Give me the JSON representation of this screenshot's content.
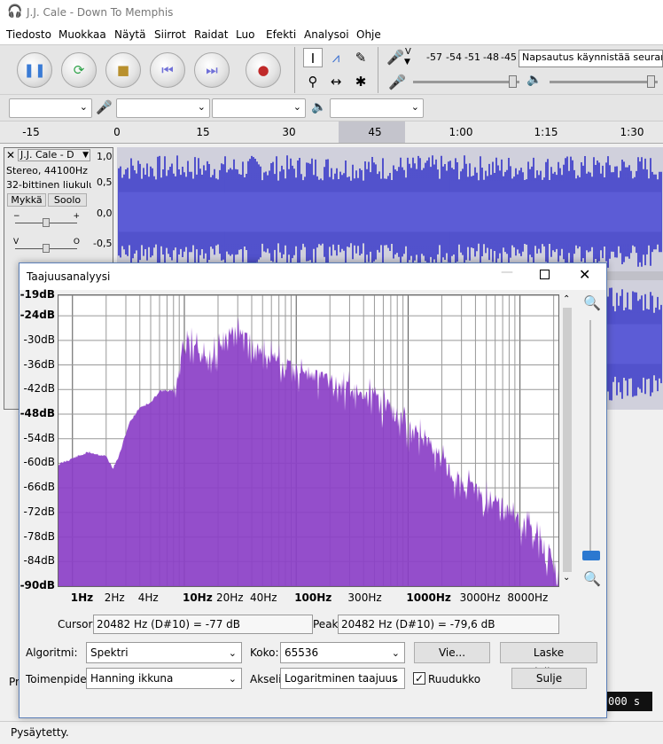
{
  "app": {
    "title": "J.J. Cale - Down To Memphis"
  },
  "menu": {
    "items": [
      "Tiedosto",
      "Muokkaa",
      "Näytä",
      "Siirrot",
      "Raidat",
      "Luo",
      "Efekti",
      "Analysoi",
      "Ohje"
    ]
  },
  "transport": {
    "buttons": [
      {
        "name": "pause-button",
        "icon": "pause-icon",
        "glyph": "❚❚",
        "color": "#3a7bd5"
      },
      {
        "name": "loop-play-button",
        "icon": "loop-icon",
        "glyph": "⟳",
        "color": "#2fa34a"
      },
      {
        "name": "stop-button",
        "icon": "stop-icon",
        "glyph": "■",
        "color": "#b8902e"
      },
      {
        "name": "skip-start-button",
        "icon": "skip-back-icon",
        "glyph": "⏮",
        "color": "#7070d8"
      },
      {
        "name": "skip-end-button",
        "icon": "skip-forward-icon",
        "glyph": "⏭",
        "color": "#7070d8"
      },
      {
        "name": "record-button",
        "icon": "record-icon",
        "glyph": "●",
        "color": "#c02a2a"
      }
    ]
  },
  "meter": {
    "mic_label": "V",
    "ticks": [
      "-57",
      "-54",
      "-51",
      "-48",
      "-45"
    ],
    "hint": "Napsautus käynnistää seurannan"
  },
  "ruler": {
    "labels": [
      "-15",
      "0",
      "15",
      "30",
      "45",
      "1:00",
      "1:15",
      "1:30"
    ]
  },
  "track": {
    "name": "J.J. Cale - D",
    "info1": "Stereo, 44100Hz",
    "info2": "32-bittinen liukuluku",
    "mute": "Mykkä",
    "solo": "Soolo",
    "scale": [
      "1,0",
      "0,5",
      "0,0",
      "-0,5"
    ]
  },
  "dialog": {
    "title": "Taajuusanalyysi",
    "db_labels": [
      "-19dB",
      "-24dB",
      "-30dB",
      "-36dB",
      "-42dB",
      "-48dB",
      "-54dB",
      "-60dB",
      "-66dB",
      "-72dB",
      "-78dB",
      "-84dB",
      "-90dB"
    ],
    "freq_labels": [
      "1Hz",
      "2Hz",
      "4Hz",
      "10Hz",
      "20Hz",
      "40Hz",
      "100Hz",
      "300Hz",
      "1000Hz",
      "3000Hz",
      "8000Hz"
    ],
    "cursor_label": "Cursor:",
    "cursor_value": "20482 Hz (D#10) = -77 dB",
    "peak_label": "Peak:",
    "peak_value": "20482 Hz (D#10) = -79,6 dB",
    "algorithm_label": "Algoritmi:",
    "algorithm_value": "Spektri",
    "size_label": "Koko:",
    "size_value": "65536",
    "export_button": "Vie...",
    "recalc_button": "Laske uudelleen...",
    "function_label": "Toimenpide",
    "function_value": "Hanning ikkuna",
    "axis_label": "Akseli",
    "axis_value": "Logaritminen taajuus",
    "grid_label": "Ruudukko",
    "grid_checked": true,
    "close_button": "Sulje",
    "spectrum_color": "#8b3fc7"
  },
  "status": {
    "text": "Pysäytetty.",
    "behind_left": "Pr",
    "behind_time": "000 s"
  }
}
